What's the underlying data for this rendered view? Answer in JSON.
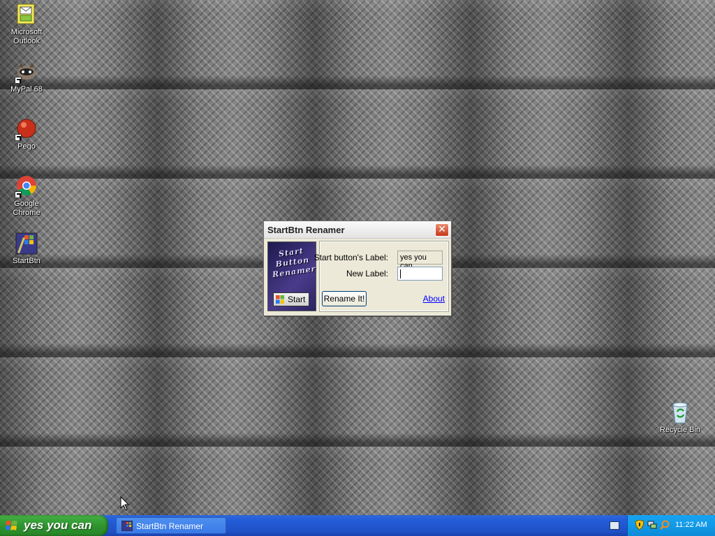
{
  "desktop": {
    "icons": [
      {
        "label": "Microsoft Outlook",
        "icon": "outlook-icon"
      },
      {
        "label": "MyPal 68",
        "icon": "mypal-icon"
      },
      {
        "label": "Pego",
        "icon": "pego-icon"
      },
      {
        "label": "Google Chrome",
        "icon": "chrome-icon"
      },
      {
        "label": "StartBtn",
        "icon": "startbtn-icon"
      },
      {
        "label": "Recycle Bin",
        "icon": "recycle-bin-icon"
      }
    ]
  },
  "dialog": {
    "title": "StartBtn Renamer",
    "logo_text": "Start Button Renamer",
    "logo_start_label": "Start",
    "current_label_caption": "Start button's Label:",
    "current_label_value": "yes you can",
    "new_label_caption": "New Label:",
    "new_label_value": "",
    "rename_button": "Rename It!",
    "about_link": "About"
  },
  "taskbar": {
    "start_label": "yes you can",
    "tasks": [
      {
        "label": "StartBtn Renamer"
      }
    ],
    "clock": "11:22 AM"
  },
  "colors": {
    "taskbar_blue": "#245edb",
    "start_green": "#2f942f",
    "tray_blue": "#129ae8",
    "dialog_bg": "#ece9d8",
    "close_red": "#c8391a"
  }
}
